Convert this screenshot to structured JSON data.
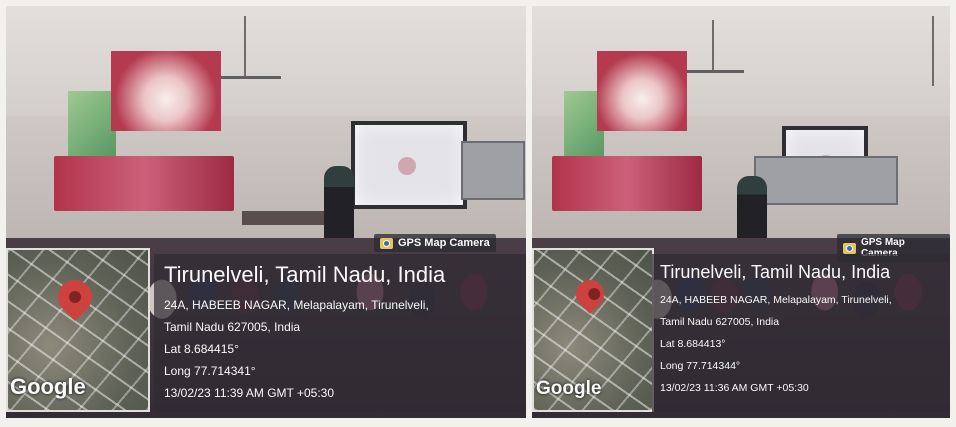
{
  "photos": [
    {
      "gps_tag": "GPS Map Camera",
      "map_logo": "Google",
      "city": "Tirunelveli, Tamil Nadu, India",
      "address_line1": "24A, HABEEB NAGAR, Melapalayam, Tirunelveli,",
      "address_line2": "Tamil Nadu 627005, India",
      "lat": "Lat 8.684415°",
      "long": "Long 77.714341°",
      "datetime": "13/02/23 11:39 AM GMT +05:30"
    },
    {
      "gps_tag": "GPS Map Camera",
      "map_logo": "Google",
      "city": "Tirunelveli, Tamil Nadu, India",
      "address_line1": "24A, HABEEB NAGAR, Melapalayam, Tirunelveli,",
      "address_line2": "Tamil Nadu 627005, India",
      "lat": "Lat 8.684413°",
      "long": "Long 77.714344°",
      "datetime": "13/02/23 11:36 AM GMT +05:30"
    }
  ]
}
